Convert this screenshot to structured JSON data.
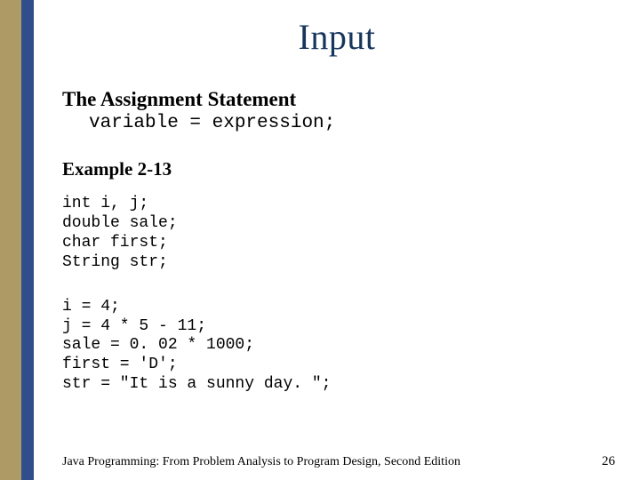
{
  "title": "Input",
  "heading": "The Assignment Statement",
  "syntax": "variable = expression;",
  "example_label": "Example 2-13",
  "decl": "int i, j;\ndouble sale;\nchar first;\nString str;",
  "assign": "i = 4;\nj = 4 * 5 - 11;\nsale = 0. 02 * 1000;\nfirst = 'D';\nstr = \"It is a sunny day. \";",
  "footer_text": "Java Programming: From Problem Analysis to Program Design, Second Edition",
  "page_number": "26"
}
